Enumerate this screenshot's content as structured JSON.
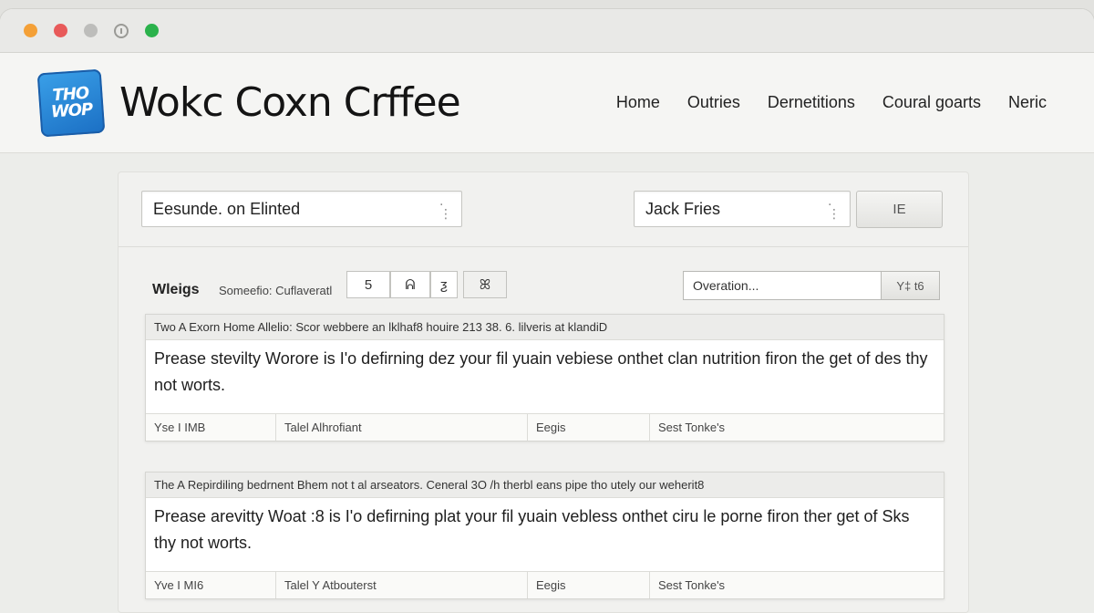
{
  "window": {
    "colors": {
      "close": "#f4a037",
      "minimize": "#e85a5a",
      "zoom": "#bdbdbb",
      "fullscreen": "#2bb24c"
    }
  },
  "header": {
    "logo_line1": "THO",
    "logo_line2": "WOP",
    "brand": "Wokc Coxn Crffee",
    "nav": [
      "Home",
      "Outries",
      "Dernetitions",
      "Coural goarts",
      "Neric"
    ]
  },
  "filters": {
    "left_select": "Eesunde. on Elinted",
    "right_select": "Jack Fries",
    "apply_label": "IE"
  },
  "toolbar": {
    "title": "Wleigs",
    "label": "Someefio: Cuflaveratl",
    "box1": "5",
    "box2": "ᕱ",
    "box3": "ƺ",
    "box4": "ꕤ",
    "search_value": "Overation...",
    "go_label": "Y‡ t6"
  },
  "posts": [
    {
      "head": "Two A Exorn Home Allelio: Scor webbere an lklhaf8 houire 213 38. 6. lilveris at klandiD",
      "body": "Prease stevilty Worore is I'o defirning dez your fil yuain vebiese onthet clan nutrition firon the get of des thy not worts.",
      "foot": [
        "Yse I IMB",
        "Talel Alhrofiant",
        "Eegis",
        "Sest Tonke's"
      ]
    },
    {
      "head": "The A Repirdiling bedrnent Bhem not t al arseators. Ceneral 3O /h therbl eans pipe tho utely our weherit8",
      "body": "Prease arevitty Woat :8 is I'o defirning plat your fil yuain vebless onthet ciru le porne firon ther get of Sks thy not worts.",
      "foot": [
        "Yve I MI6",
        "Talel Y Atbouterst",
        "Eegis",
        "Sest Tonke's"
      ]
    }
  ]
}
